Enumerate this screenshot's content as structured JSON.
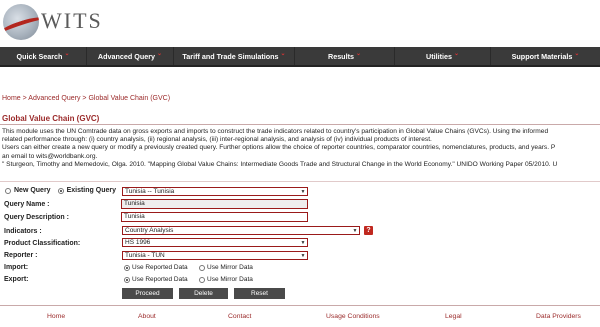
{
  "logo": {
    "text": "WITS"
  },
  "nav": [
    {
      "label": "Quick Search"
    },
    {
      "label": "Advanced Query"
    },
    {
      "label": "Tariff and Trade Simulations"
    },
    {
      "label": "Results"
    },
    {
      "label": "Utilities"
    },
    {
      "label": "Support Materials"
    }
  ],
  "breadcrumb": {
    "home": "Home",
    "sep1": ">",
    "advanced": "Advanced Query",
    "sep2": ">",
    "current": "Global Value Chain (GVC)"
  },
  "page_title": "Global Value Chain (GVC)",
  "description": [
    "This module uses the UN Comtrade data on gross exports and imports to construct the trade indicators related to country's participation in Global Value Chains (GVCs). Using the informed",
    "related performance through: (i) country analysis, (ii) regional analysis, (iii) inter-regional analysis, and analysis of (iv) individual products of interest.",
    "Users can either create a new query or modify a previously created query. Further options allow the choice of reporter countries, comparator countries, nomenclatures, products, and years. P",
    "an email to wits@worldbank.org.",
    "\" Sturgeon, Timothy and Memedovic, Olga. 2010. \"Mapping Global Value Chains: Intermediate Goods Trade and Structural Change in the World Economy.\" UNIDO Working Paper 05/2010. U"
  ],
  "form": {
    "new_query_label": "New Query",
    "existing_query_label": "Existing Query",
    "existing_query_value": "Tunisia -- Tunisia",
    "query_name_label": "Query Name :",
    "query_name_value": "Tunisia",
    "query_description_label": "Query Description :",
    "query_description_value": "Tunisia",
    "indicators_label": "Indicators :",
    "indicators_value": "Country Analysis",
    "help_icon_text": "?",
    "product_classification_label": "Product Classification:",
    "product_classification_value": "HS 1996",
    "reporter_label": "Reporter :",
    "reporter_value": "Tunisia - TUN",
    "import_label": "Import:",
    "export_label": "Export:",
    "use_reported_label": "Use Reported Data",
    "use_mirror_label": "Use Mirror Data",
    "proceed_label": "Proceed",
    "delete_label": "Delete",
    "reset_label": "Reset"
  },
  "footer": [
    {
      "label": "Home"
    },
    {
      "label": "About"
    },
    {
      "label": "Contact"
    },
    {
      "label": "Usage Conditions"
    },
    {
      "label": "Legal"
    },
    {
      "label": "Data Providers"
    }
  ],
  "colors": {
    "accent": "#9b2a2a",
    "nav_bg": "#3a3a3a",
    "button_bg": "#4a4a4a",
    "help_icon": "#c0281f"
  }
}
